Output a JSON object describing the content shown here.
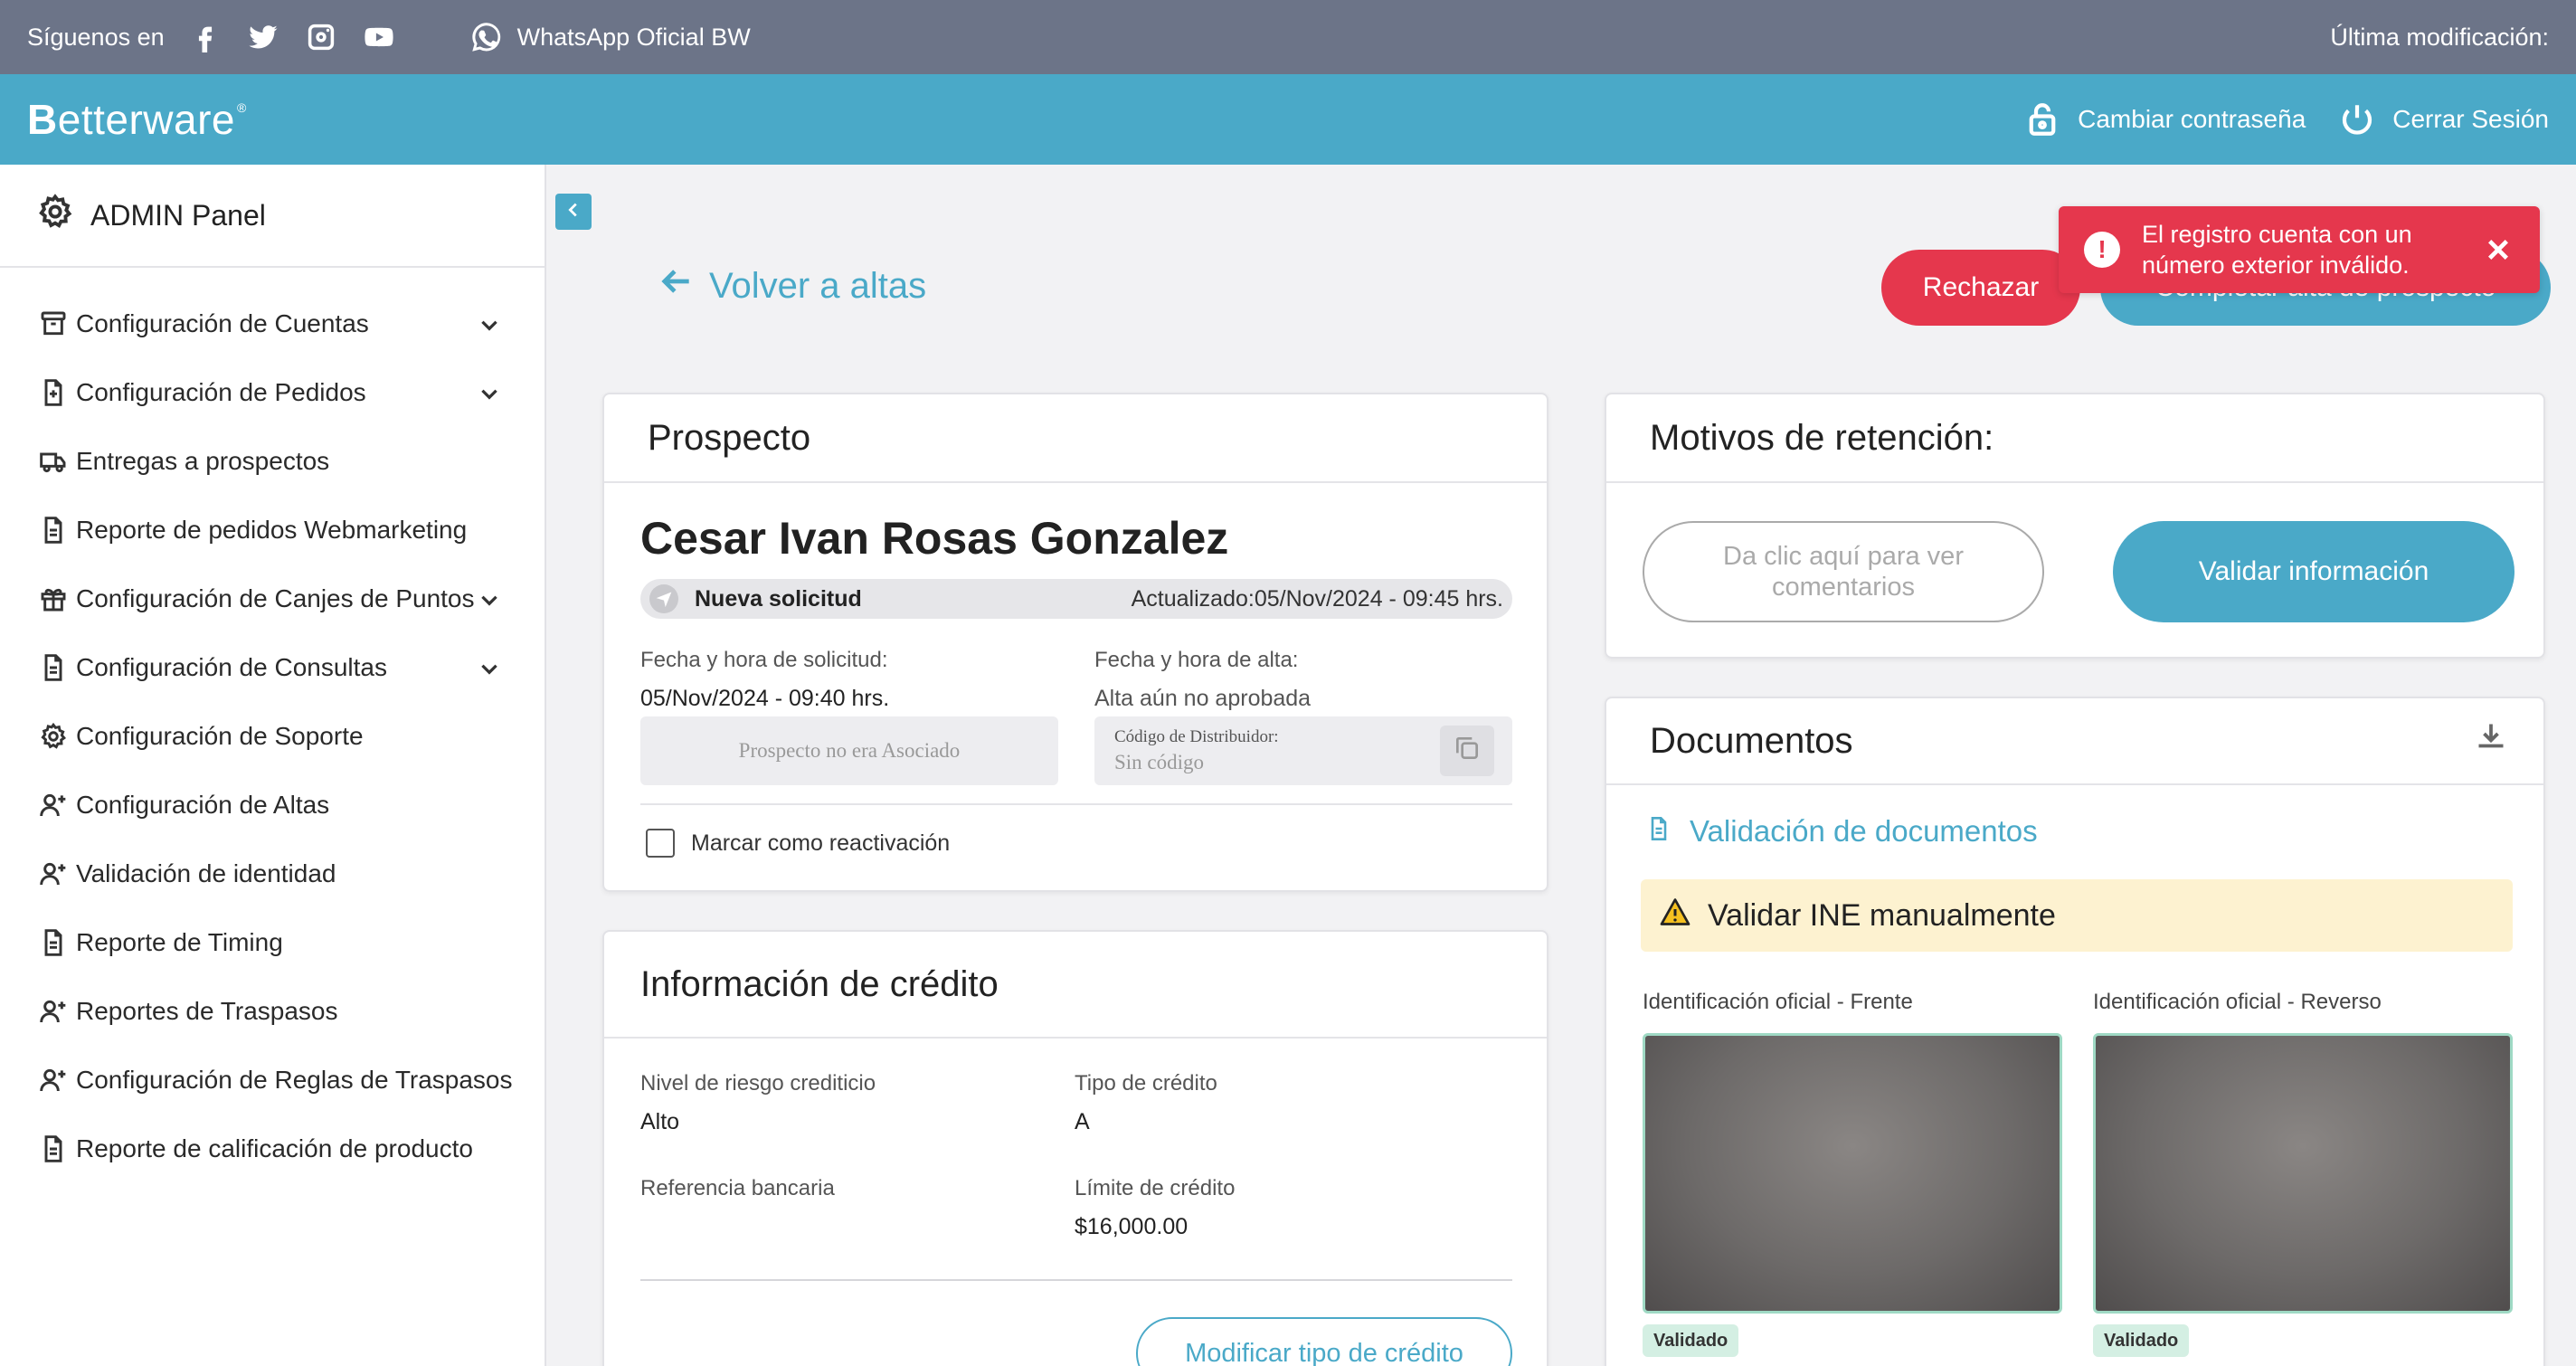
{
  "topbar": {
    "follow_label": "Síguenos en",
    "social_icons": [
      "facebook-icon",
      "twitter-icon",
      "instagram-icon",
      "youtube-icon"
    ],
    "whatsapp_label": "WhatsApp Oficial BW",
    "last_modified_label": "Última modificación:"
  },
  "header": {
    "brand_prefix": "B",
    "brand_rest": "etterware",
    "brand_mark": "®",
    "change_password": "Cambiar contraseña",
    "logout": "Cerrar Sesión"
  },
  "sidebar": {
    "title": "ADMIN Panel",
    "items": [
      {
        "label": "Configuración de Cuentas",
        "icon": "archive-icon",
        "expandable": true
      },
      {
        "label": "Configuración de Pedidos",
        "icon": "order-doc-icon",
        "expandable": true
      },
      {
        "label": "Entregas a prospectos",
        "icon": "truck-icon",
        "expandable": false
      },
      {
        "label": "Reporte de pedidos Webmarketing",
        "icon": "document-icon",
        "expandable": false
      },
      {
        "label": "Configuración de Canjes de Puntos",
        "icon": "gift-icon",
        "expandable": true
      },
      {
        "label": "Configuración de Consultas",
        "icon": "document-icon",
        "expandable": true
      },
      {
        "label": "Configuración de Soporte",
        "icon": "gear-icon",
        "expandable": false
      },
      {
        "label": "Configuración de Altas",
        "icon": "user-plus-icon",
        "expandable": false
      },
      {
        "label": "Validación de identidad",
        "icon": "user-plus-icon",
        "expandable": false
      },
      {
        "label": "Reporte de Timing",
        "icon": "document-icon",
        "expandable": false
      },
      {
        "label": "Reportes de Traspasos",
        "icon": "user-plus-icon",
        "expandable": false
      },
      {
        "label": "Configuración de Reglas de Traspasos",
        "icon": "user-plus-icon",
        "expandable": false
      },
      {
        "label": "Reporte de calificación de producto",
        "icon": "document-icon",
        "expandable": false
      }
    ]
  },
  "main": {
    "back_label": "Volver a altas",
    "reject_label": "Rechazar",
    "complete_label": "Completar alta de prospecto"
  },
  "toast": {
    "message": "El registro cuenta con un número exterior inválido."
  },
  "prospect": {
    "title": "Prospecto",
    "name": "Cesar Ivan Rosas Gonzalez",
    "status_label": "Nueva solicitud",
    "updated_label": "Actualizado:",
    "updated_value": "05/Nov/2024 - 09:45 hrs.",
    "request_date_label": "Fecha y hora de solicitud:",
    "request_date_value": "05/Nov/2024 - 09:40 hrs.",
    "approval_date_label": "Fecha y hora de alta:",
    "approval_date_value": "Alta aún no aprobada",
    "associate_note": "Prospecto no era Asociado",
    "distributor_code_label": "Código de Distribuidor:",
    "distributor_code_value": "Sin código",
    "reactivation_label": "Marcar como reactivación"
  },
  "credit": {
    "title": "Información de crédito",
    "risk_label": "Nivel de riesgo crediticio",
    "risk_value": "Alto",
    "type_label": "Tipo de crédito",
    "type_value": "A",
    "bank_ref_label": "Referencia bancaria",
    "limit_label": "Límite de crédito",
    "limit_value": "$16,000.00",
    "modify_label": "Modificar tipo de crédito"
  },
  "retention": {
    "title": "Motivos de retención:",
    "comments_label": "Da clic aquí para ver comentarios",
    "validate_label": "Validar información"
  },
  "documents": {
    "title": "Documentos",
    "validation_link": "Validación de documentos",
    "warning": "Validar INE manualmente",
    "front_label": "Identificación oficial - Frente",
    "back_label": "Identificación oficial - Reverso",
    "front_status": "Validado",
    "back_status": "Validado"
  },
  "colors": {
    "brand": "#4aa9c8",
    "topbar": "#6c7488",
    "danger": "#e5374d",
    "warning_bg": "#fdf2d0",
    "success_bg": "#d4efe3"
  }
}
